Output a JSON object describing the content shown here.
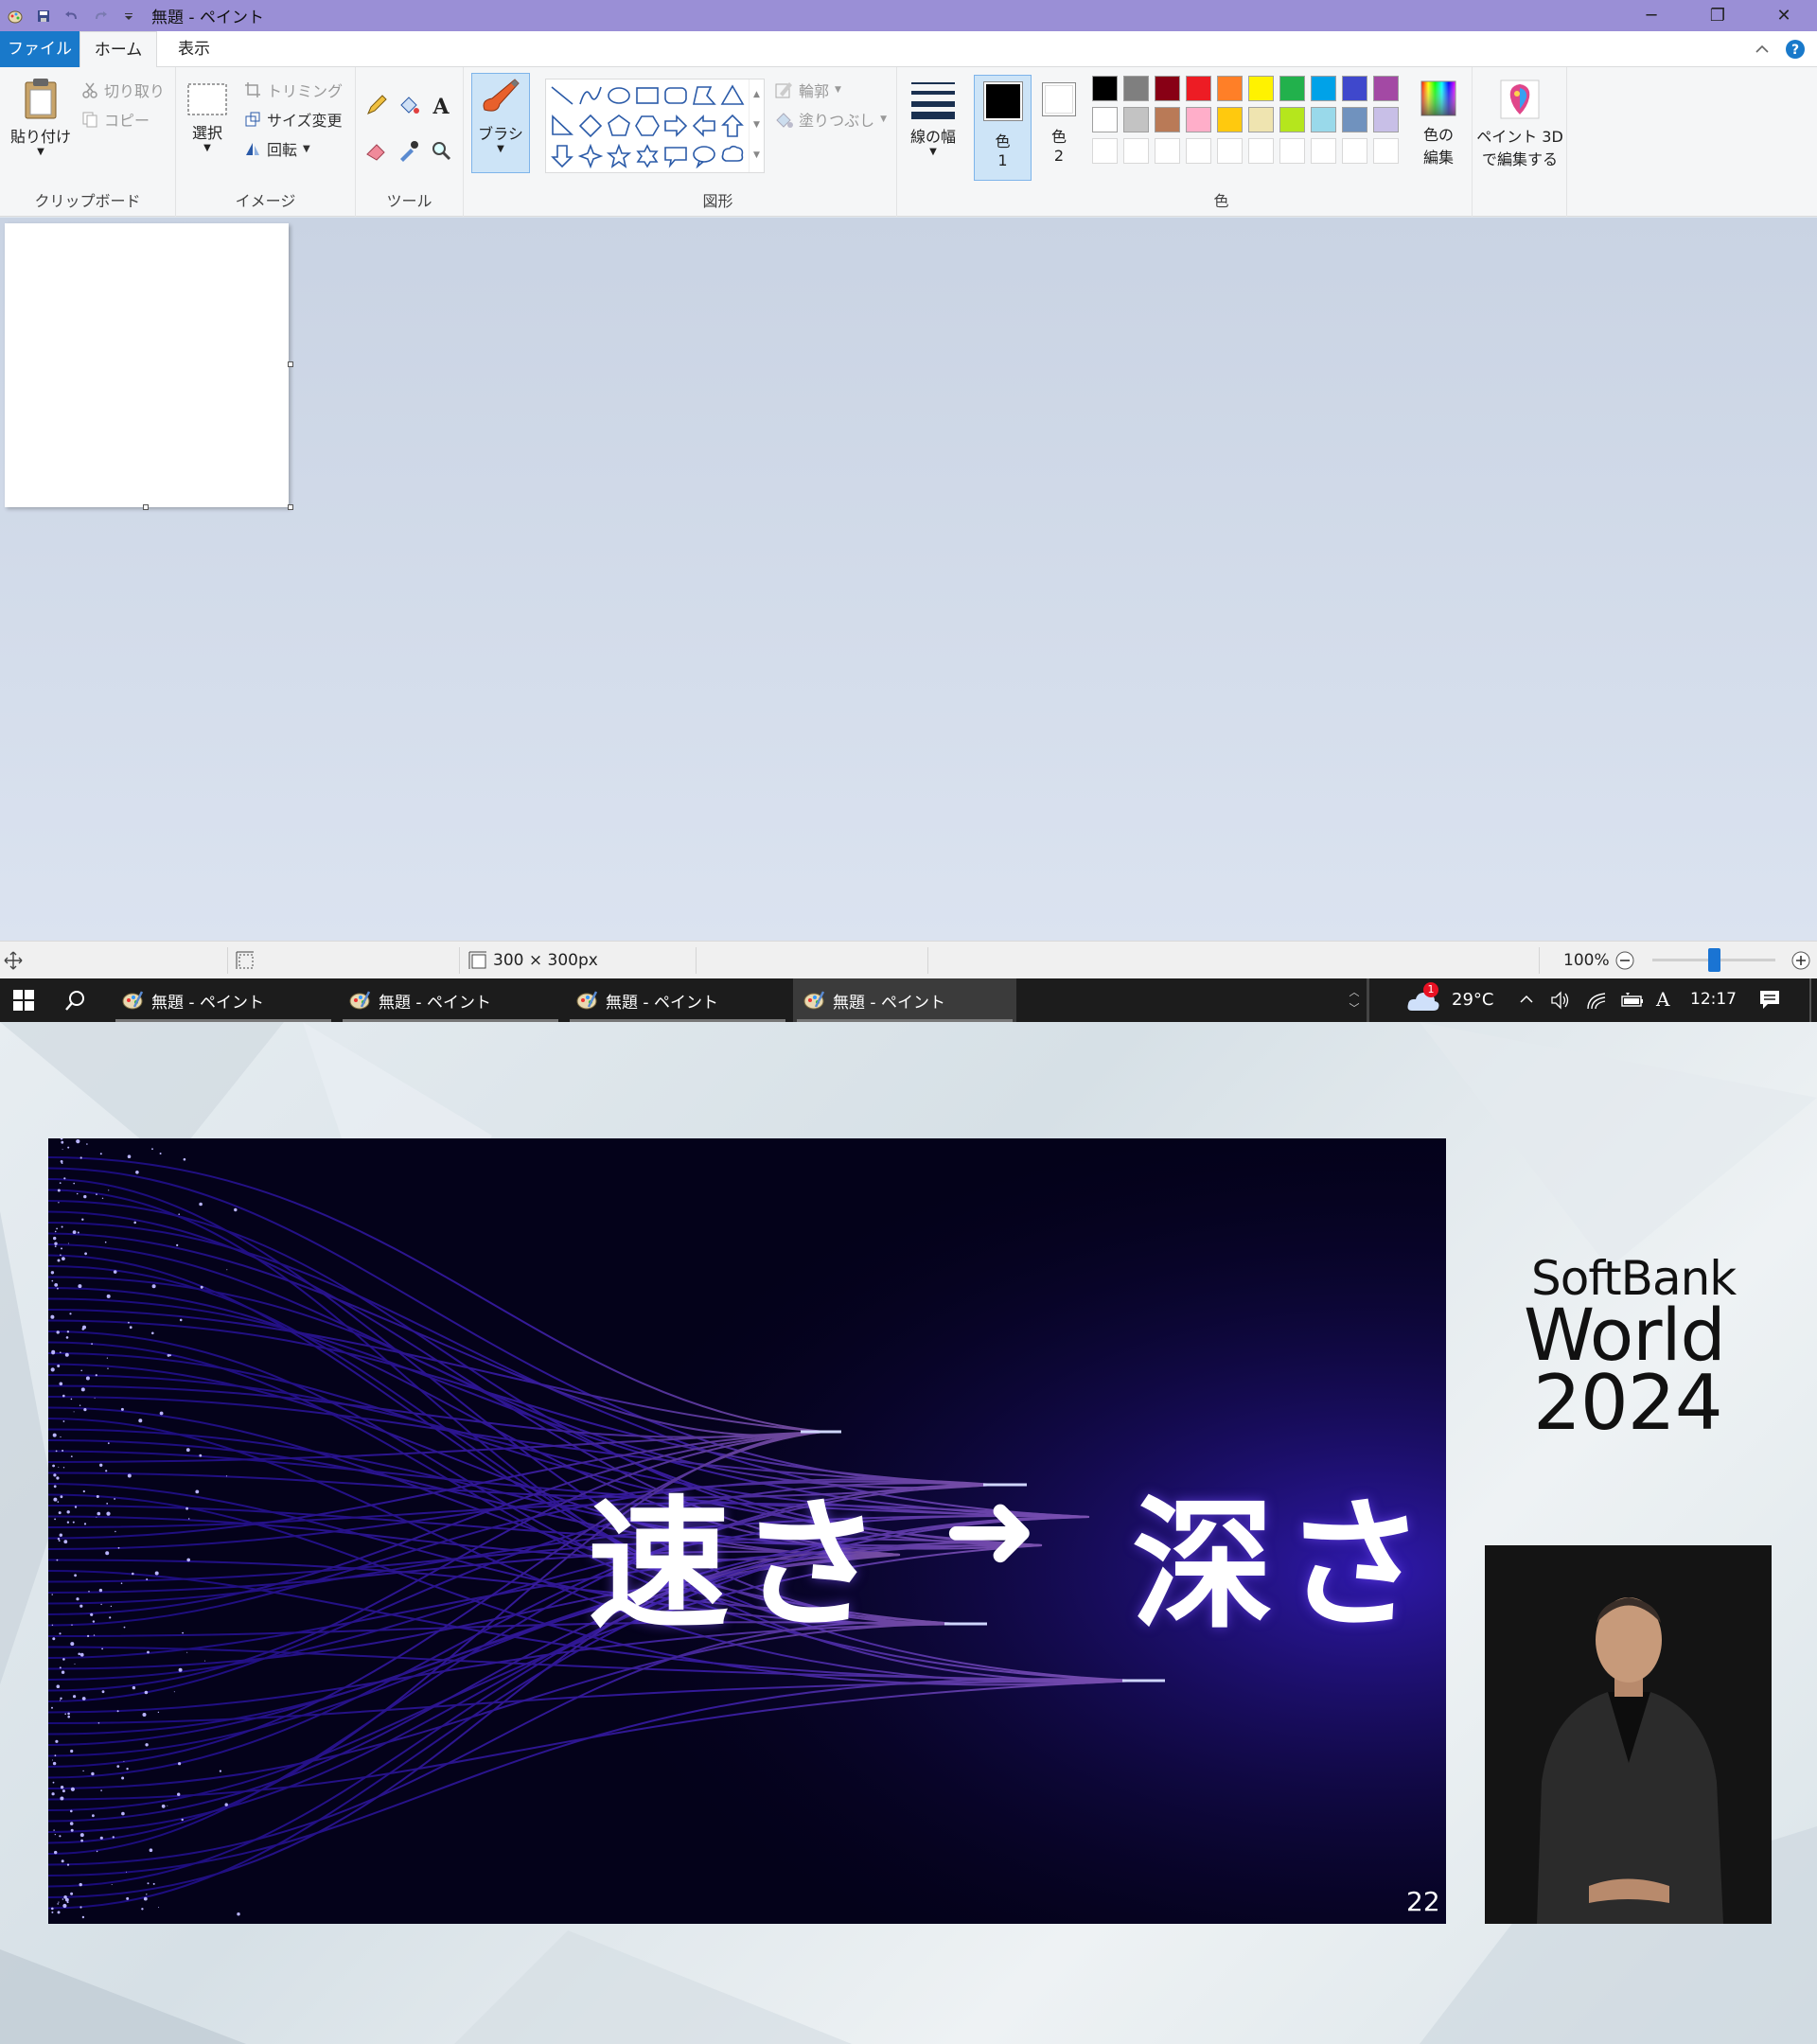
{
  "window": {
    "title": "無題 - ペイント",
    "controls": {
      "minimize": "─",
      "restore": "❐",
      "close": "✕"
    }
  },
  "tabs": {
    "file": "ファイル",
    "home": "ホーム",
    "view": "表示"
  },
  "ribbon": {
    "clipboard": {
      "paste": "貼り付け",
      "cut": "切り取り",
      "copy": "コピー",
      "label": "クリップボード"
    },
    "image": {
      "select": "選択",
      "crop": "トリミング",
      "resize": "サイズ変更",
      "rotate": "回転",
      "label": "イメージ"
    },
    "tools": {
      "label": "ツール"
    },
    "brush": {
      "label": "ブラシ"
    },
    "shapes": {
      "outline": "輪郭",
      "fill": "塗りつぶし",
      "label": "図形"
    },
    "size": {
      "label": "線の幅"
    },
    "colors": {
      "color1_line1": "色",
      "color1_line2": "1",
      "color2_line1": "色",
      "color2_line2": "2",
      "edit_line1": "色の",
      "edit_line2": "編集",
      "label": "色",
      "row1": [
        "#000000",
        "#7f7f7f",
        "#880015",
        "#ed1c24",
        "#ff7f27",
        "#fff200",
        "#22b14c",
        "#00a2e8",
        "#3f48cc",
        "#a349a4"
      ],
      "row2": [
        "#ffffff",
        "#c3c3c3",
        "#b97a57",
        "#ffaec9",
        "#ffc90e",
        "#efe4b0",
        "#b5e61d",
        "#99d9ea",
        "#7092be",
        "#c8bfe7"
      ]
    },
    "paint3d": {
      "line1": "ペイント 3D",
      "line2": "で編集する"
    }
  },
  "status": {
    "canvas_size": "300 × 300px",
    "zoom": "100%",
    "zoom_fraction": 0.5
  },
  "taskbar": {
    "tasks": [
      "無題 - ペイント",
      "無題 - ペイント",
      "無題 - ペイント",
      "無題 - ペイント"
    ],
    "weather": "29°C",
    "weather_badge": "1",
    "ime": "A",
    "time": "12:17"
  },
  "slide": {
    "text_left": "速さ",
    "text_right": "深さ",
    "arrow": "➜",
    "page": "22"
  },
  "event": {
    "line1": "SoftBank",
    "line2": "World",
    "line3": "2024"
  }
}
